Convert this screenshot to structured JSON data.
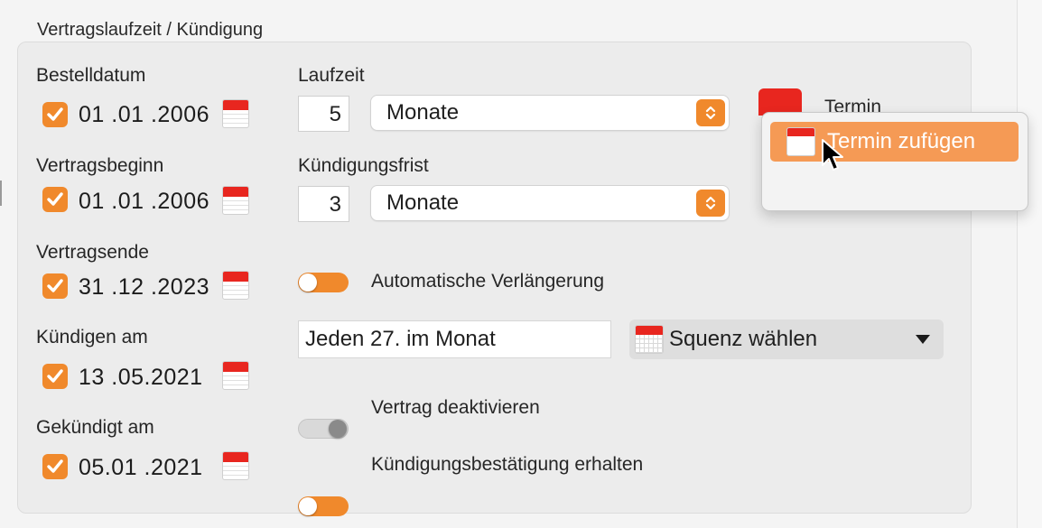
{
  "section_title": "Vertragslaufzeit / Kündigung",
  "dates": [
    {
      "label": "Bestelldatum",
      "value": "01 .01 .2006",
      "checked": true
    },
    {
      "label": "Vertragsbeginn",
      "value": "01 .01 .2006",
      "checked": true
    },
    {
      "label": "Vertragsende",
      "value": "31 .12 .2023",
      "checked": true
    },
    {
      "label": "Kündigen am",
      "value": "13 .05.2021",
      "checked": true
    },
    {
      "label": "Gekündigt am",
      "value": "05.01 .2021",
      "checked": true
    }
  ],
  "laufzeit": {
    "label": "Laufzeit",
    "number": "5",
    "unit": "Monate"
  },
  "kuendigungsfrist": {
    "label": "Kündigungsfrist",
    "number": "3",
    "unit": "Monate"
  },
  "auto_verlaengerung": {
    "label": "Automatische Verlängerung",
    "on": true
  },
  "sequence": {
    "text": "Jeden 27. im Monat",
    "button_label": "Squenz wählen"
  },
  "deaktivieren": {
    "label": "Vertrag deaktivieren",
    "on": false
  },
  "bestaetigung": {
    "label": "Kündigungsbestätigung erhalten",
    "on": true
  },
  "termin": {
    "peek_label": "Termin",
    "menu_item": "Termin zufügen"
  },
  "colors": {
    "accent": "#f0892c",
    "calendar_red": "#e8261f",
    "menu_highlight": "#f59a55"
  },
  "icons": [
    "checkmark-icon",
    "calendar-icon",
    "chevron-updown-icon",
    "triangle-down-icon",
    "pointer-cursor-icon"
  ]
}
